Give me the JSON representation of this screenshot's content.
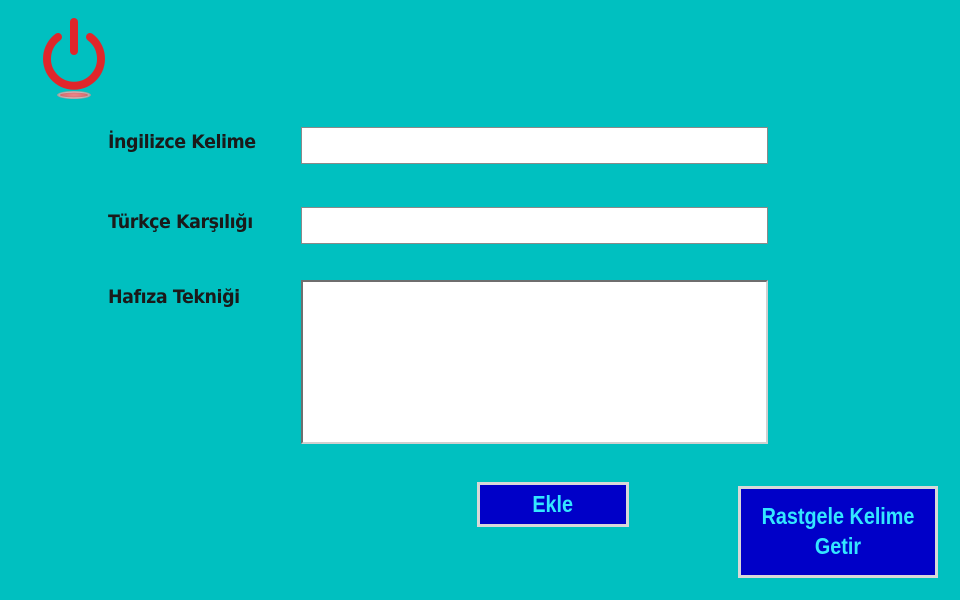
{
  "form": {
    "english_word_label": "İngilizce Kelime",
    "english_word_value": "",
    "turkish_meaning_label": "Türkçe Karşılığı",
    "turkish_meaning_value": "",
    "memory_technique_label": "Hafıza Tekniği",
    "memory_technique_value": ""
  },
  "buttons": {
    "add_label": "Ekle",
    "random_word_label": "Rastgele Kelime Getir"
  },
  "icons": {
    "power": "power-icon"
  },
  "colors": {
    "background": "#00c0c0",
    "power_icon": "#e0262b",
    "button_bg": "#0000c8",
    "button_text": "#33e6ff"
  }
}
